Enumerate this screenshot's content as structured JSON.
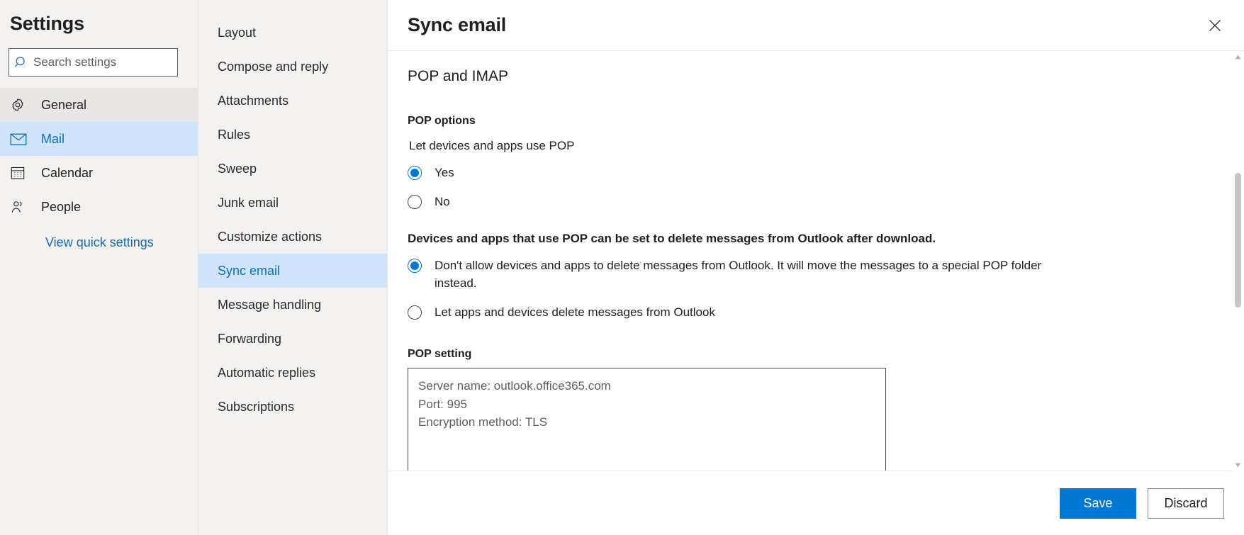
{
  "sidebar": {
    "title": "Settings",
    "search": {
      "placeholder": "Search settings",
      "value": "",
      "icon": "search-icon"
    },
    "items": [
      {
        "label": "General",
        "icon": "gear-icon",
        "state": "hovered"
      },
      {
        "label": "Mail",
        "icon": "envelope-icon",
        "state": "selected"
      },
      {
        "label": "Calendar",
        "icon": "calendar-icon",
        "state": "normal"
      },
      {
        "label": "People",
        "icon": "people-icon",
        "state": "normal"
      }
    ],
    "quick_settings_link": "View quick settings"
  },
  "midnav": {
    "items": [
      {
        "label": "Layout",
        "state": "normal"
      },
      {
        "label": "Compose and reply",
        "state": "normal"
      },
      {
        "label": "Attachments",
        "state": "normal"
      },
      {
        "label": "Rules",
        "state": "normal"
      },
      {
        "label": "Sweep",
        "state": "normal"
      },
      {
        "label": "Junk email",
        "state": "normal"
      },
      {
        "label": "Customize actions",
        "state": "normal"
      },
      {
        "label": "Sync email",
        "state": "selected"
      },
      {
        "label": "Message handling",
        "state": "normal"
      },
      {
        "label": "Forwarding",
        "state": "normal"
      },
      {
        "label": "Automatic replies",
        "state": "normal"
      },
      {
        "label": "Subscriptions",
        "state": "normal"
      }
    ]
  },
  "content": {
    "header_title": "Sync email",
    "close_icon": "close-icon",
    "section_title": "POP and IMAP",
    "pop_options_label": "POP options",
    "use_pop_label": "Let devices and apps use POP",
    "use_pop_choices": [
      {
        "label": "Yes",
        "checked": true
      },
      {
        "label": "No",
        "checked": false
      }
    ],
    "delete_statement": "Devices and apps that use POP can be set to delete messages from Outlook after download.",
    "delete_choices": [
      {
        "label": "Don't allow devices and apps to delete messages from Outlook. It will move the messages to a special POP folder instead.",
        "checked": true
      },
      {
        "label": "Let apps and devices delete messages from Outlook",
        "checked": false
      }
    ],
    "pop_setting_label": "POP setting",
    "pop_setting_value": "Server name: outlook.office365.com\nPort: 995\nEncryption method: TLS"
  },
  "footer": {
    "save_label": "Save",
    "discard_label": "Discard"
  },
  "scrollbar": {
    "up_icon": "scroll-up-arrow-icon",
    "down_icon": "scroll-down-arrow-icon"
  },
  "colors": {
    "accent": "#0078d4",
    "selected_bg": "#cfe4fa",
    "selected_text": "#0f6cbd",
    "pane_bg": "#f3f2f1"
  }
}
